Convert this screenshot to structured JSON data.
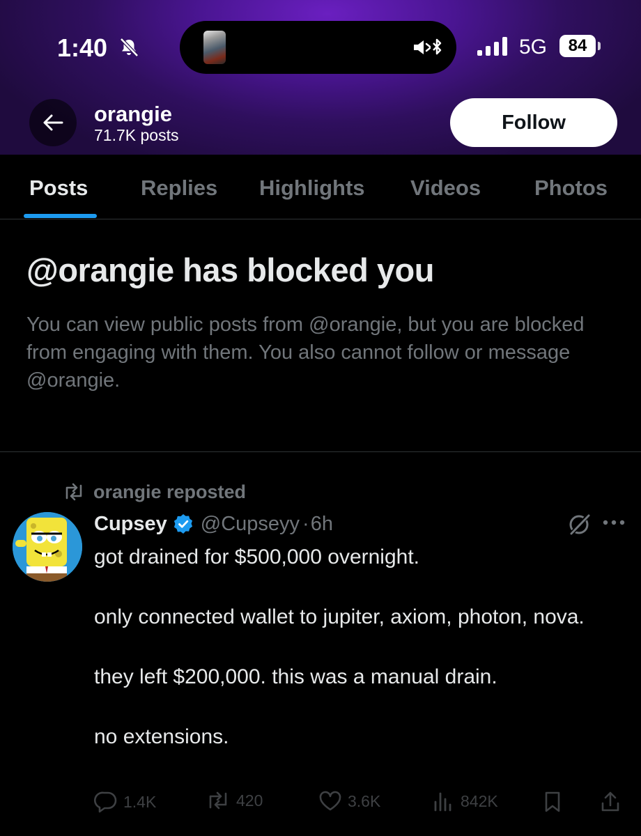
{
  "status_bar": {
    "time": "1:40",
    "network": "5G",
    "battery": "84"
  },
  "profile": {
    "name": "orangie",
    "posts_count": "71.7K posts",
    "follow_label": "Follow"
  },
  "tabs": [
    "Posts",
    "Replies",
    "Highlights",
    "Videos",
    "Photos"
  ],
  "active_tab": "Posts",
  "blocked": {
    "title": "@orangie has blocked you",
    "description": "You can view public posts from @orangie, but you are blocked from engaging with them. You also cannot follow or message @orangie."
  },
  "post": {
    "repost_label": "orangie reposted",
    "author_name": "Cupsey",
    "author_handle": "@Cupseyy",
    "time": "6h",
    "paragraphs": [
      "got drained for $500,000 overnight.",
      "only connected wallet to jupiter, axiom, photon, nova.",
      "they left $200,000. this was a manual drain.",
      "no extensions."
    ],
    "stats": {
      "replies": "1.4K",
      "reposts": "420",
      "likes": "3.6K",
      "views": "842K"
    }
  },
  "colors": {
    "accent": "#1d9bf0",
    "muted": "#71767b",
    "header_purple": "#4a1592"
  }
}
